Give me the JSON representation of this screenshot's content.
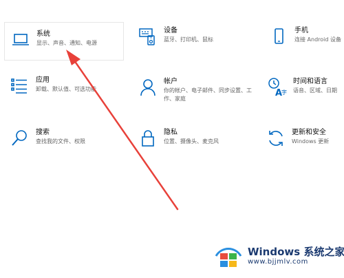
{
  "tiles": {
    "system": {
      "name": "系统",
      "desc": "显示、声音、通知、电源"
    },
    "devices": {
      "name": "设备",
      "desc": "蓝牙、打印机、鼠标"
    },
    "phone": {
      "name": "手机",
      "desc": "连接 Android 设备"
    },
    "apps": {
      "name": "应用",
      "desc": "卸载、默认值、可选功能"
    },
    "accounts": {
      "name": "帐户",
      "desc": "你的帐户、电子邮件、同步设置、工作、家庭"
    },
    "time": {
      "name": "时间和语言",
      "desc": "语音、区域、日期"
    },
    "search": {
      "name": "搜索",
      "desc": "查找我的文件、权限"
    },
    "privacy": {
      "name": "隐私",
      "desc": "位置、摄像头、麦克风"
    },
    "update": {
      "name": "更新和安全",
      "desc": "Windows 更新"
    }
  },
  "watermark": {
    "brand": "Windows",
    "brand_cn": "系统之家",
    "url": "www.bjjmlv.com"
  },
  "colors": {
    "icon": "#0067c0",
    "arrow": "#e8413a",
    "text": "#111111",
    "desc": "#666666"
  },
  "icons": {
    "system": "laptop-icon",
    "devices": "keyboard-speaker-icon",
    "phone": "phone-icon",
    "apps": "list-icon",
    "accounts": "person-icon",
    "time": "language-icon",
    "search": "search-icon",
    "privacy": "lock-icon",
    "update": "sync-icon"
  }
}
